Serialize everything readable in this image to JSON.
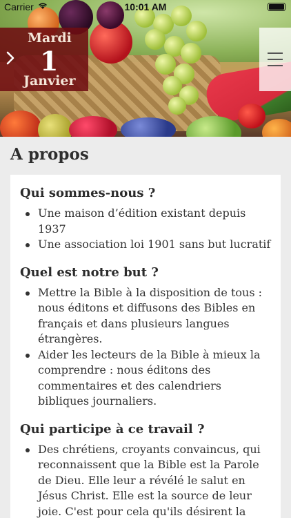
{
  "status_bar": {
    "carrier": "Carrier",
    "time": "10:01 AM"
  },
  "date": {
    "weekday": "Mardi",
    "day": "1",
    "month": "Janvier"
  },
  "page": {
    "title": "A propos"
  },
  "sections": [
    {
      "heading": "Qui sommes-nous ?",
      "items": [
        "Une maison d’édition existant depuis 1937",
        "Une association loi 1901 sans but lucratif"
      ]
    },
    {
      "heading": "Quel est notre but ?",
      "items": [
        "Mettre la Bible à la disposition de tous : nous éditons et diffusons des Bibles en français et dans plusieurs langues étrangères.",
        "Aider les lecteurs de la Bible à mieux la comprendre : nous éditons des commentaires et des calendriers bibliques journaliers."
      ]
    },
    {
      "heading": "Qui participe à  ce travail ?",
      "items": [
        "Des chrétiens, croyants convaincus, qui reconnaissent que la Bible est la Parole de Dieu. Elle leur a révélé le salut en Jésus Christ. Elle est la source de leur joie. C'est pour cela qu'ils désirent la faire connaître à d'autres."
      ]
    }
  ],
  "icons": {
    "wifi": "wifi-icon",
    "battery": "battery-icon",
    "next": "chevron-right-icon",
    "menu": "hamburger-menu-icon"
  },
  "colors": {
    "date_box": "#700e12",
    "background": "#ececec"
  }
}
